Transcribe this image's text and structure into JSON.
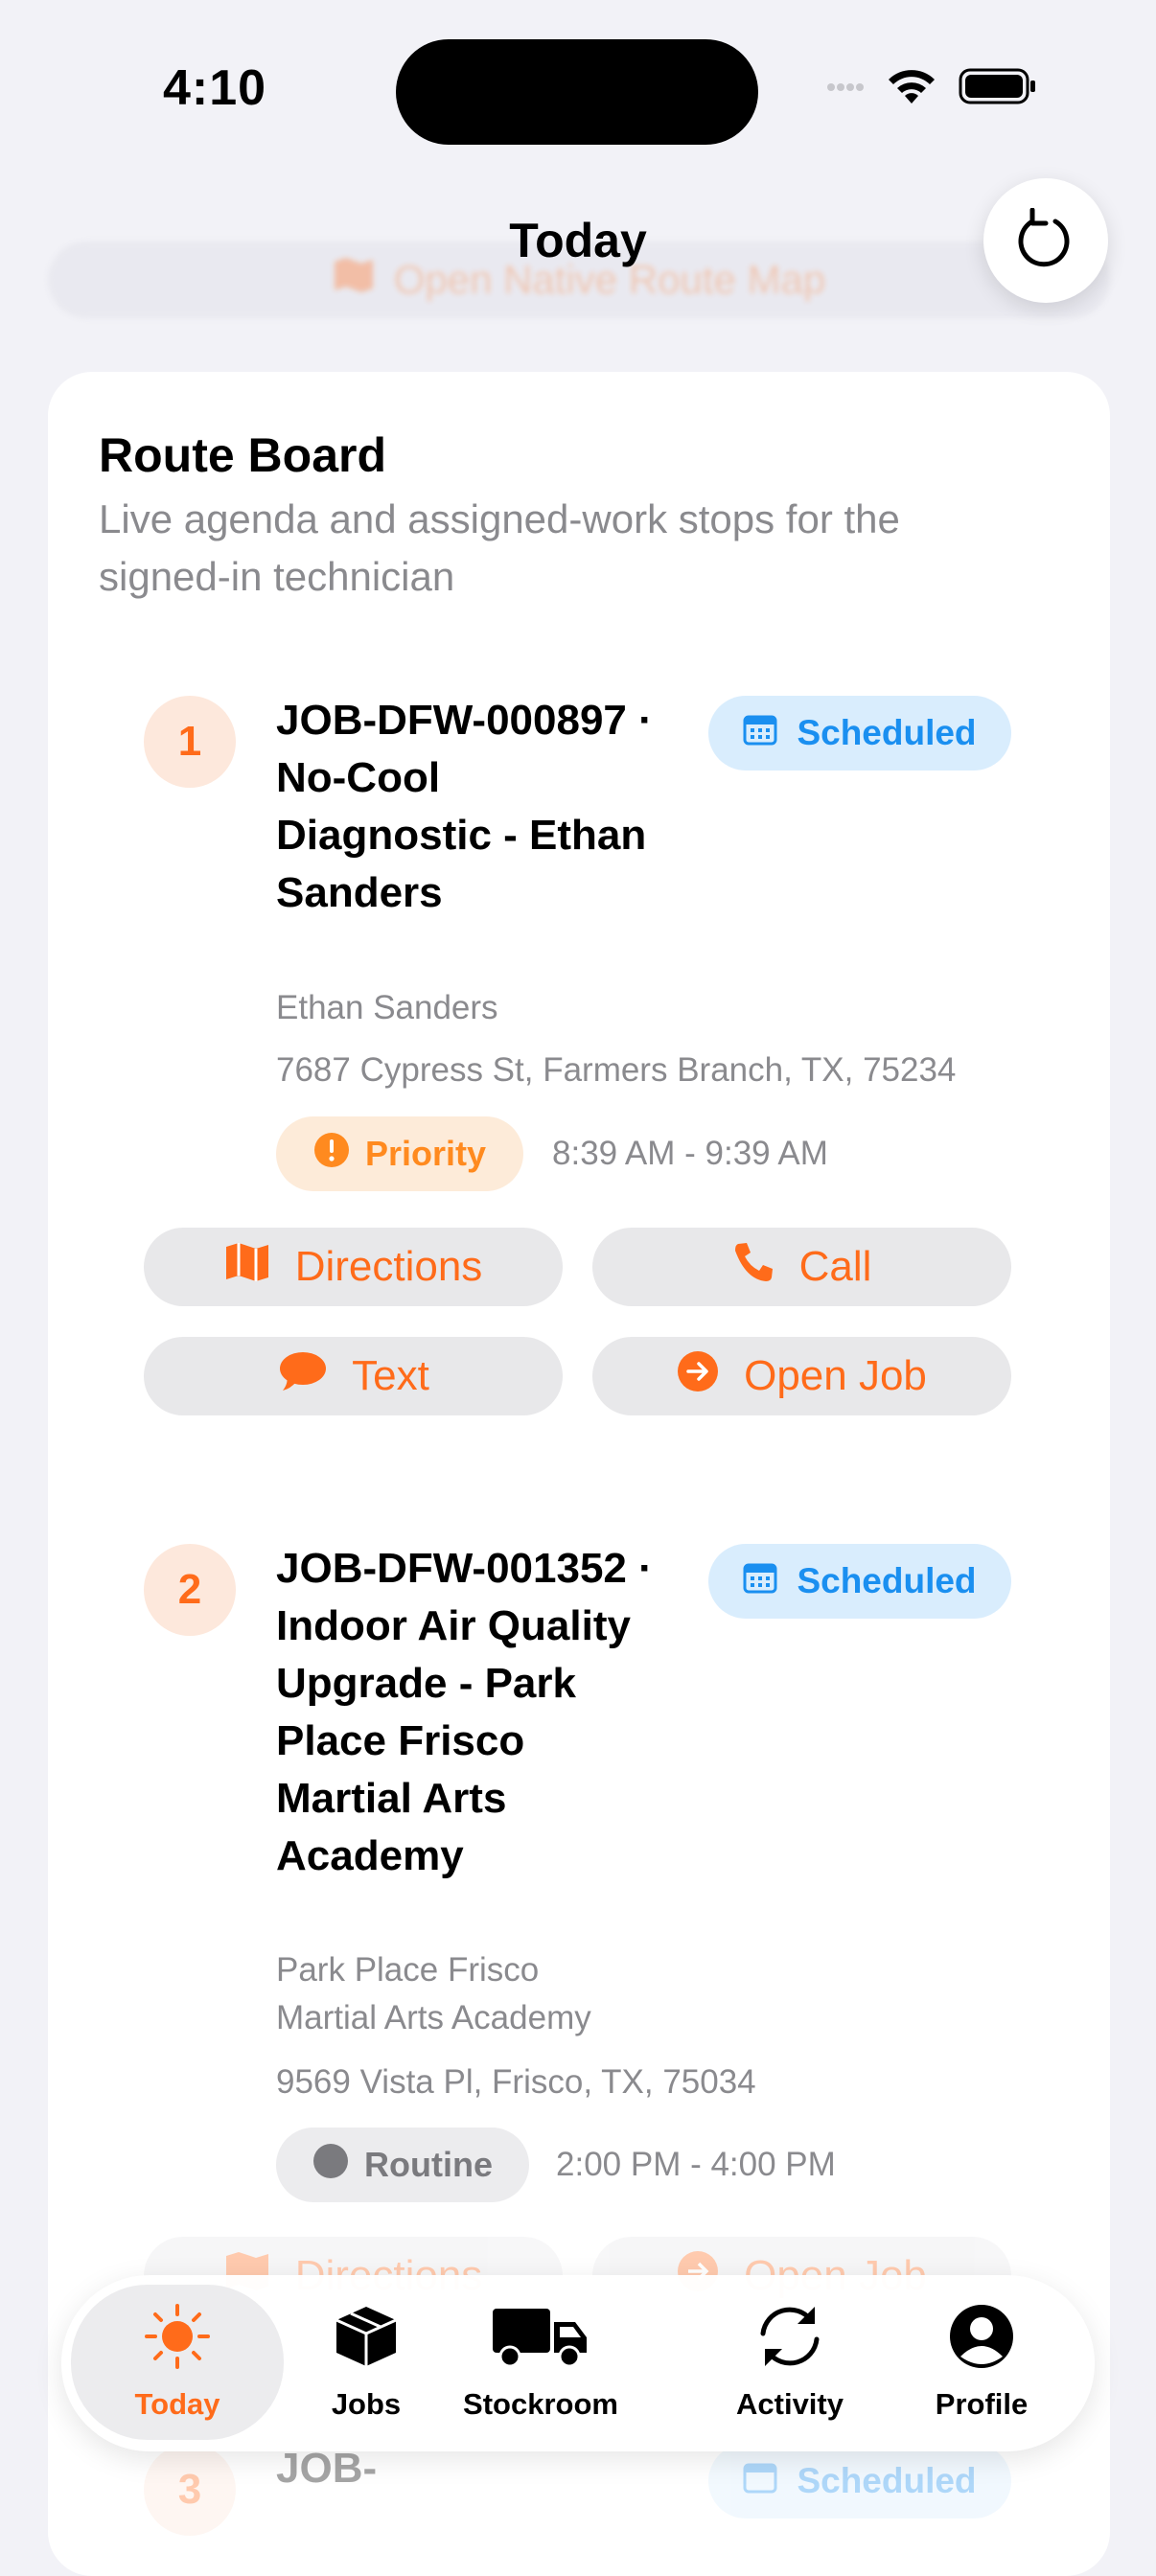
{
  "status_bar": {
    "time": "4:10"
  },
  "header": {
    "title": "Today",
    "hidden_button_label": "Open Native Route Map"
  },
  "route_board": {
    "title": "Route Board",
    "subtitle": "Live agenda and assigned-work stops for the signed-in technician"
  },
  "jobs": [
    {
      "number": "1",
      "title": "JOB-DFW-000897 · No-Cool Diagnostic - Ethan Sanders",
      "status": "Scheduled",
      "customer": "Ethan Sanders",
      "address": "7687 Cypress St, Farmers Branch, TX, 75234",
      "priority": "Priority",
      "time": "8:39 AM - 9:39 AM",
      "actions": {
        "directions": "Directions",
        "call": "Call",
        "text": "Text",
        "open": "Open Job"
      }
    },
    {
      "number": "2",
      "title": "JOB-DFW-001352 · Indoor Air Quality Upgrade - Park Place Frisco Martial Arts Academy",
      "status": "Scheduled",
      "customer": "Park Place Frisco Martial Arts Academy",
      "address": "9569 Vista Pl, Frisco, TX, 75034",
      "priority": "Routine",
      "time": "2:00 PM - 4:00 PM",
      "actions": {
        "directions": "Directions",
        "open": "Open Job"
      }
    },
    {
      "number": "3",
      "title": "JOB-",
      "status": "Scheduled"
    }
  ],
  "tabs": [
    {
      "label": "Today",
      "icon": "sun-icon",
      "active": true
    },
    {
      "label": "Jobs",
      "icon": "box-icon"
    },
    {
      "label": "Stockroom",
      "icon": "truck-icon"
    },
    {
      "label": "Activity",
      "icon": "sync-icon"
    },
    {
      "label": "Profile",
      "icon": "person-circle-icon"
    }
  ],
  "colors": {
    "accent": "#ff6b1a",
    "scheduled": "#1a8ff0",
    "muted": "#8a8a8e"
  }
}
